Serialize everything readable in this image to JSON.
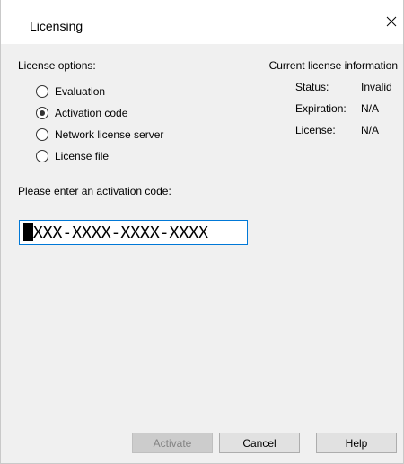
{
  "window": {
    "title": "Licensing",
    "close_icon": "close-icon"
  },
  "license_options": {
    "label": "License options:",
    "options": [
      {
        "label": "Evaluation",
        "selected": false
      },
      {
        "label": "Activation code",
        "selected": true
      },
      {
        "label": "Network license server",
        "selected": false
      },
      {
        "label": "License file",
        "selected": false
      }
    ]
  },
  "current_license": {
    "title": "Current license information",
    "status_label": "Status:",
    "status_value": "Invalid",
    "expiration_label": "Expiration:",
    "expiration_value": "N/A",
    "license_label": "License:",
    "license_value": "N/A"
  },
  "activation": {
    "prompt": "Please enter an activation code:",
    "code_value": "XXXX-XXXX-XXXX-XXXX"
  },
  "buttons": {
    "activate": "Activate",
    "activate_enabled": false,
    "cancel": "Cancel",
    "help": "Help"
  },
  "colors": {
    "focus_border": "#0078d7",
    "disabled_text": "#838383"
  }
}
